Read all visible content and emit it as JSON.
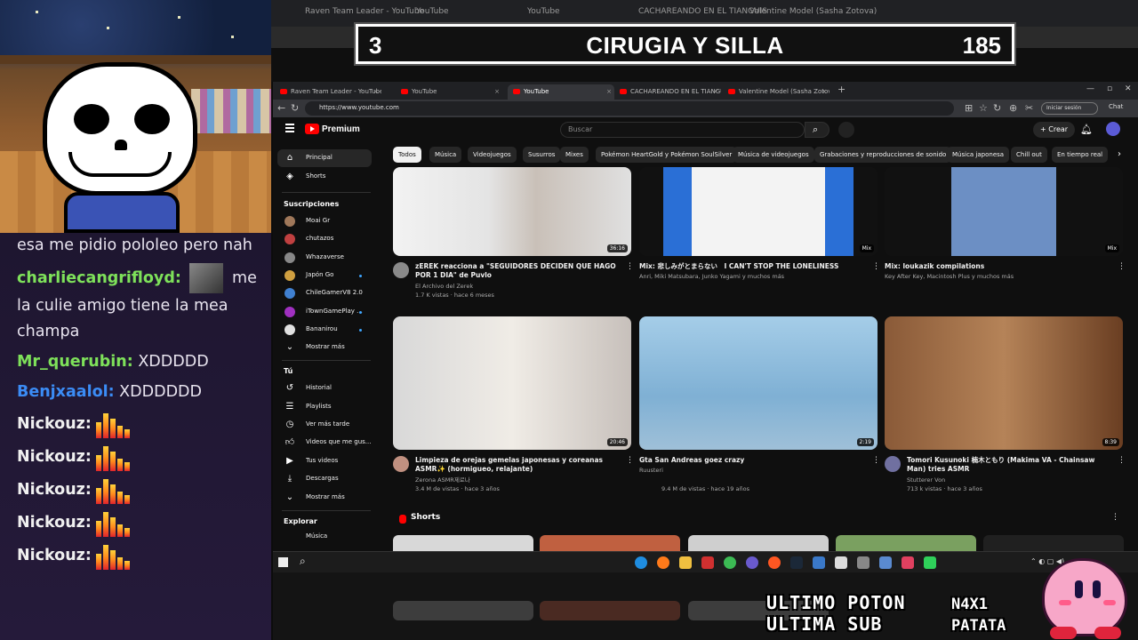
{
  "overlay": {
    "number": "3",
    "title": "CIRUGIA Y SILLA",
    "count": "185"
  },
  "chat": [
    {
      "user": "",
      "text": "esa me pidio pololeo pero nah",
      "color": "#e8e4ef"
    },
    {
      "user": "charliecangrifloyd:",
      "text": "me la culie amigo tiene la mea champa",
      "color": "#7ee15a",
      "has_avatar": true
    },
    {
      "user": "Mr_querubin:",
      "text": "XDDDDD",
      "color": "#7ee15a"
    },
    {
      "user": "Benjxaalol:",
      "text": "XDDDDDD",
      "color": "#3b8cf5"
    },
    {
      "user": "Nickouz:",
      "text": "",
      "color": "#f0f0f0",
      "emote": "bars-emote"
    },
    {
      "user": "Nickouz:",
      "text": "",
      "color": "#f0f0f0",
      "emote": "bars-emote"
    },
    {
      "user": "Nickouz:",
      "text": "",
      "color": "#f0f0f0",
      "emote": "bars-emote"
    },
    {
      "user": "Nickouz:",
      "text": "",
      "color": "#f0f0f0",
      "emote": "bars-emote"
    },
    {
      "user": "Nickouz:",
      "text": "",
      "color": "#f0f0f0",
      "emote": "bars-emote"
    }
  ],
  "bg_tabs": [
    "Raven Team Leader - YouTube",
    "YouTube",
    "YouTube",
    "CACHAREANDO EN EL TIANGUIS",
    "Valentine Model (Sasha Zotova)"
  ],
  "tabs": [
    {
      "label": "Raven Team Leader - YouTube",
      "active": false
    },
    {
      "label": "YouTube",
      "active": false
    },
    {
      "label": "YouTube",
      "active": true
    },
    {
      "label": "CACHAREANDO EN EL TIANGUIS",
      "active": false
    },
    {
      "label": "Valentine Model (Sasha Zotova)",
      "active": false
    }
  ],
  "address": {
    "url": "https://www.youtube.com",
    "signin_label": "Iniciar sesión",
    "chat_label": "Chat"
  },
  "yt": {
    "brand": "Premium",
    "search_placeholder": "Buscar",
    "create_label": "Crear"
  },
  "sidebar": {
    "main": [
      {
        "label": "Principal",
        "icon": "home-icon",
        "active": true
      },
      {
        "label": "Shorts",
        "icon": "shorts-icon",
        "active": false
      }
    ],
    "subs_heading": "Suscripciones",
    "subs": [
      {
        "label": "Moai Gr",
        "color": "#a0785a",
        "dot": false
      },
      {
        "label": "chutazos",
        "color": "#c04040",
        "dot": false
      },
      {
        "label": "Whazaverse",
        "color": "#888888",
        "dot": false
      },
      {
        "label": "Japón Go",
        "color": "#d0a040",
        "dot": true
      },
      {
        "label": "ChileGamerV8 2.0",
        "color": "#4080d0",
        "dot": false
      },
      {
        "label": "iTownGamePlay ...",
        "color": "#a030c0",
        "dot": true
      },
      {
        "label": "Bananirou",
        "color": "#e0e0e0",
        "dot": true
      }
    ],
    "more_label": "Mostrar más",
    "you_heading": "Tú",
    "you": [
      {
        "label": "Historial",
        "icon": "history-icon"
      },
      {
        "label": "Playlists",
        "icon": "playlist-icon"
      },
      {
        "label": "Ver más tarde",
        "icon": "clock-icon"
      },
      {
        "label": "Videos que me gus...",
        "icon": "thumbs-up-icon"
      },
      {
        "label": "Tus videos",
        "icon": "play-icon"
      },
      {
        "label": "Descargas",
        "icon": "download-icon"
      }
    ],
    "more_label_2": "Mostrar más",
    "explore_heading": "Explorar",
    "explore_first": "Música"
  },
  "chips": [
    "Todos",
    "Música",
    "Videojuegos",
    "Susurros",
    "Mixes",
    "Pokémon HeartGold y Pokémon SoulSilver",
    "Música de videojuegos",
    "Grabaciones y reproducciones de sonido",
    "Música japonesa",
    "Chill out",
    "En tiempo real"
  ],
  "videos": [
    {
      "title": "zEREK reacciona a \"SEGUIDORES DECIDEN QUE HAGO POR 1 DIA\" de Puvlo",
      "channel": "El Archivo del Zerek",
      "meta": "1.7 K vistas · hace 6 meses",
      "duration": "36:16",
      "avatar": true
    },
    {
      "title": "Mix: 悲しみがとまらない　I CAN'T STOP THE LONELINESS",
      "channel": "Anri, Miki Matsubara, Junko Yagami y muchos más",
      "meta": "",
      "duration": "Mix",
      "avatar": false
    },
    {
      "title": "Mix: loukazik compilations",
      "channel": "Key After Key, Macintosh Plus y muchos más",
      "meta": "",
      "duration": "Mix",
      "avatar": false
    },
    {
      "title": "Limpieza de orejas gemelas japonesas y coreanas ASMR✨ (hormigueo, relajante)",
      "channel": "Zerona ASMR제로나",
      "meta": "3.4 M de vistas · hace 3 años",
      "duration": "20:46",
      "avatar": true
    },
    {
      "title": "Gta San Andreas goez crazy",
      "channel": "Ruusteri",
      "meta": "9.4 M de vistas · hace 19 años",
      "duration": "2:19",
      "avatar": false
    },
    {
      "title": "Tomori Kusunoki 楠木ともり (Makima VA - Chainsaw Man) tries ASMR",
      "channel": "Stutterer Von",
      "meta": "713 k vistas · hace 3 años",
      "duration": "8:39",
      "avatar": true
    }
  ],
  "shorts_heading": "Shorts",
  "overlay_text": {
    "line1": "ULTIMO POTON",
    "line2": "ULTIMA SUB",
    "name1": "N4X1",
    "name2": "PATATA"
  },
  "colors": {
    "yt_red": "#ff0000",
    "accent_blue": "#3ea6ff"
  }
}
